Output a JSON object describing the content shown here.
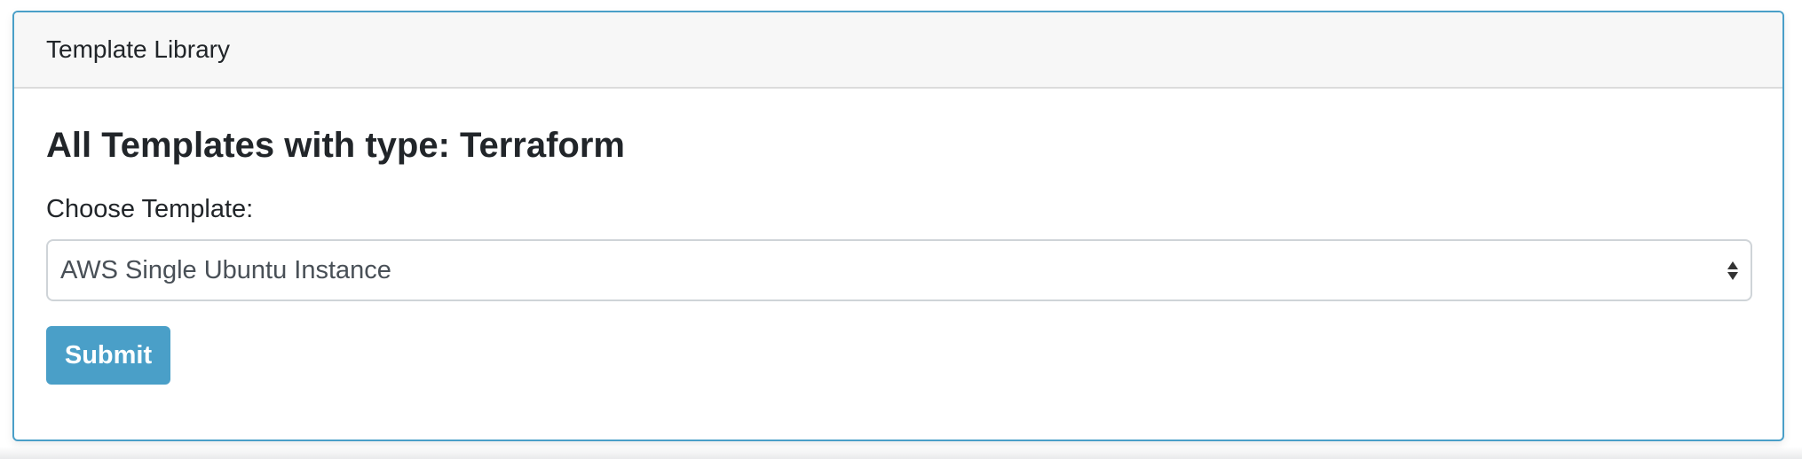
{
  "panel": {
    "header_title": "Template Library"
  },
  "main": {
    "heading": "All Templates with type: Terraform",
    "choose_label": "Choose Template:",
    "template_select": {
      "selected_value": "AWS Single Ubuntu Instance"
    },
    "submit_label": "Submit"
  },
  "colors": {
    "accent": "#4a9fc8",
    "header_background": "#f7f7f7",
    "text": "#212529"
  },
  "icons": {
    "select_arrows": "up-down-arrows-icon"
  }
}
